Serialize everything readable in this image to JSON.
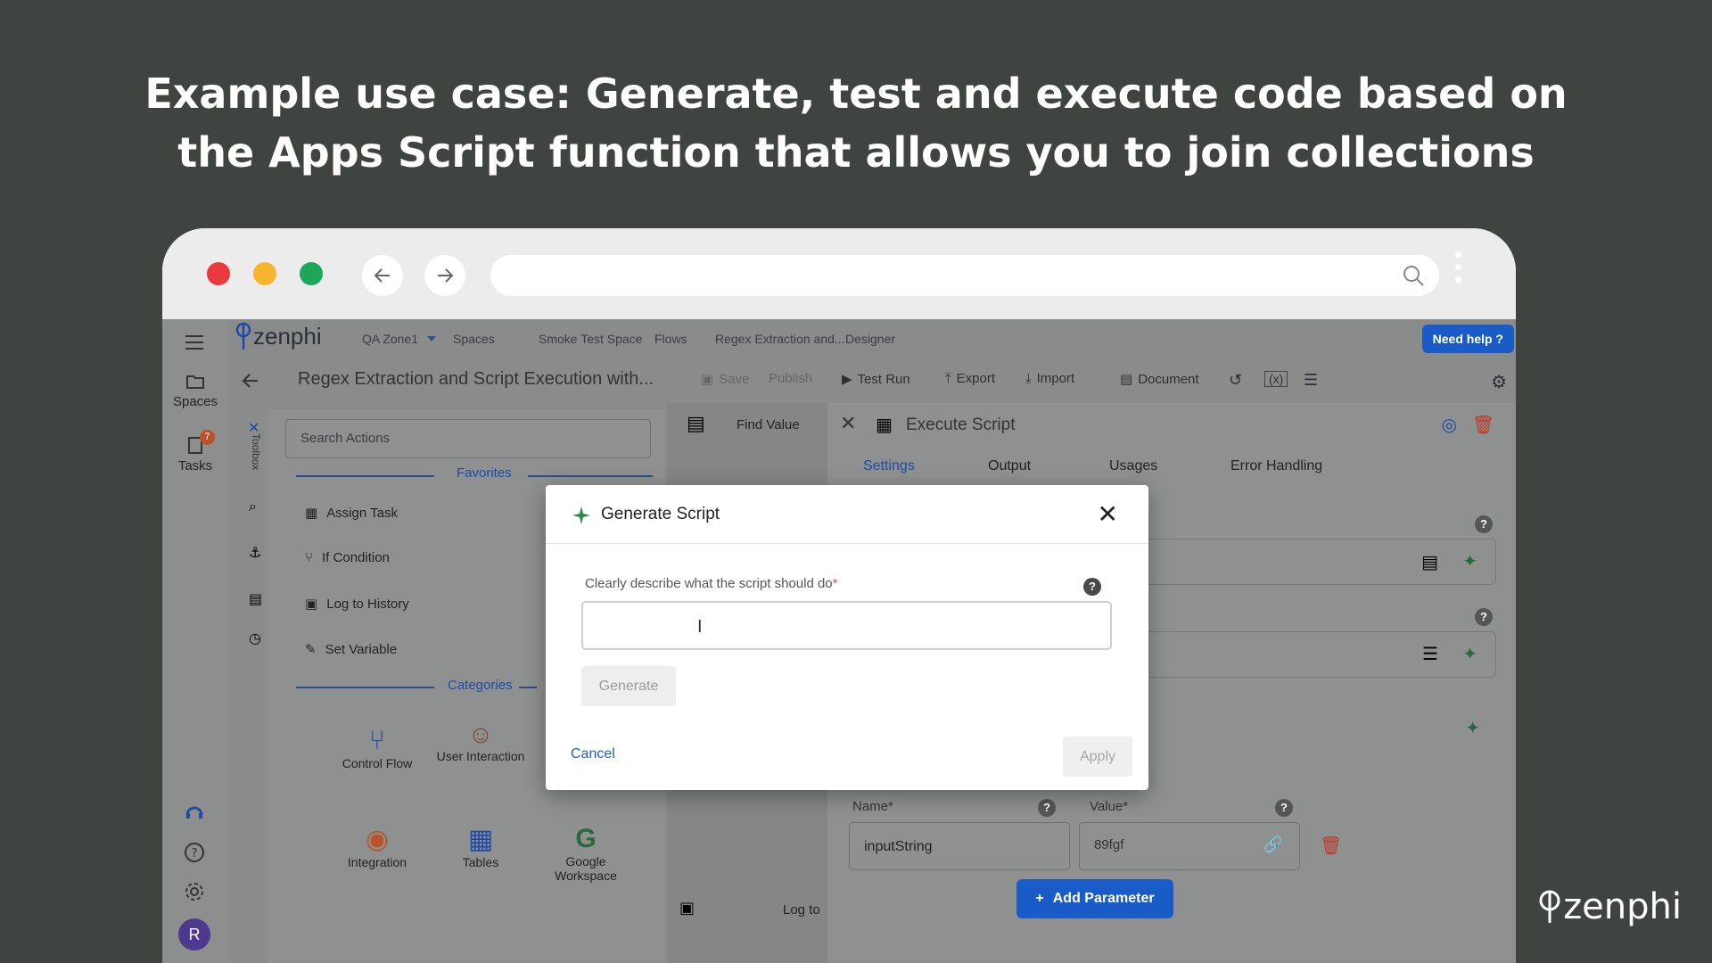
{
  "headline": {
    "line1": "Example use case: Generate, test and execute code based on",
    "line2": "the Apps Script function that allows you to join collections"
  },
  "brand": {
    "corner_logo": "zenphi"
  },
  "browser": {
    "traffic_colors": [
      "#ea3a3d",
      "#f5b62e",
      "#1ea65b"
    ]
  },
  "app": {
    "logo": "zenphi",
    "breadcrumb": [
      "QA Zone1",
      "Spaces",
      "Smoke Test Space",
      "Flows",
      "Regex Extraction and...",
      "Designer"
    ],
    "help_button": "Need help ?",
    "nav": {
      "spaces": "Spaces",
      "tasks": "Tasks",
      "tasks_badge": "7",
      "user_initial": "R"
    },
    "flow_title": "Regex Extraction and Script Execution with...",
    "toolbar": {
      "save": "Save",
      "publish": "Publish",
      "test_run": "Test Run",
      "export": "Export",
      "import": "Import",
      "document": "Document"
    },
    "toolbox": {
      "rail_label": "Toolbox",
      "search_placeholder": "Search Actions",
      "favorites_label": "Favorites",
      "favorites": [
        "Assign Task",
        "If Condition",
        "Log to History",
        "Set Variable"
      ],
      "categories_label": "Categories",
      "categories": [
        "Control Flow",
        "User Interaction",
        "Integration",
        "Tables",
        "Google Workspace"
      ]
    },
    "canvas": {
      "node1": "Find Value",
      "node2": "Log to"
    },
    "panel": {
      "title": "Execute Script",
      "tabs": [
        "Settings",
        "Output",
        "Usages",
        "Error Handling"
      ],
      "name_label": "Name*",
      "value_label": "Value*",
      "param_name": "inputString",
      "param_value": "89fgf",
      "add_parameter": "Add Parameter"
    }
  },
  "modal": {
    "title": "Generate Script",
    "prompt_label": "Clearly describe what the script should do",
    "required_mark": "*",
    "input_value": "",
    "generate_button": "Generate",
    "cancel_button": "Cancel",
    "apply_button": "Apply"
  }
}
